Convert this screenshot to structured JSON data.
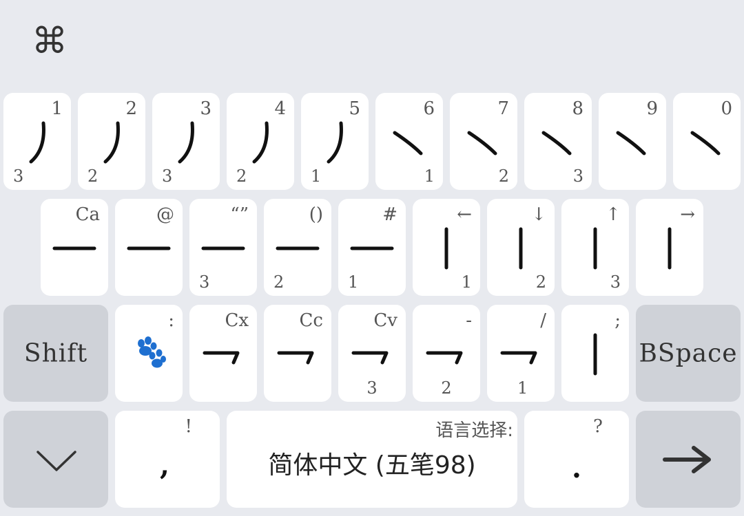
{
  "toolbar": {
    "cmd_symbol": "⌘"
  },
  "rows": {
    "row1": {
      "keys": [
        {
          "sup": "1",
          "sub": "3"
        },
        {
          "sup": "2",
          "sub": "2"
        },
        {
          "sup": "3",
          "sub": "3"
        },
        {
          "sup": "4",
          "sub": "2"
        },
        {
          "sup": "5",
          "sub": "1"
        },
        {
          "sup": "6",
          "sub": "1"
        },
        {
          "sup": "7",
          "sub": "2"
        },
        {
          "sup": "8",
          "sub": "3"
        },
        {
          "sup": "9",
          "sub": ""
        },
        {
          "sup": "0",
          "sub": ""
        }
      ]
    },
    "row2": {
      "keys": [
        {
          "sup": "Ca",
          "sub": ""
        },
        {
          "sup": "@",
          "sub": ""
        },
        {
          "sup": "“”",
          "sub": "3"
        },
        {
          "sup": "()",
          "sub": "2"
        },
        {
          "sup": "#",
          "sub": "1"
        },
        {
          "sup": "←",
          "sub": "1"
        },
        {
          "sup": "↓",
          "sub": "2"
        },
        {
          "sup": "↑",
          "sub": "3"
        },
        {
          "sup": "→",
          "sub": ""
        }
      ]
    },
    "row3": {
      "shift_label": "Shift",
      "keys": [
        {
          "sup": ":",
          "sub": ""
        },
        {
          "sup": "Cx",
          "sub": ""
        },
        {
          "sup": "Cc",
          "sub": ""
        },
        {
          "sup": "Cv",
          "sub": "3"
        },
        {
          "sup": "-",
          "sub": "2"
        },
        {
          "sup": "/",
          "sub": "1"
        },
        {
          "sup": ";",
          "sub": ""
        }
      ],
      "bspace_label": "BSpace"
    },
    "row4": {
      "comma_sup": "!",
      "comma_main": ",",
      "space_hint": "语言选择:",
      "space_label": "简体中文 (五笔98)",
      "period_sup": "?",
      "period_main": "."
    }
  }
}
